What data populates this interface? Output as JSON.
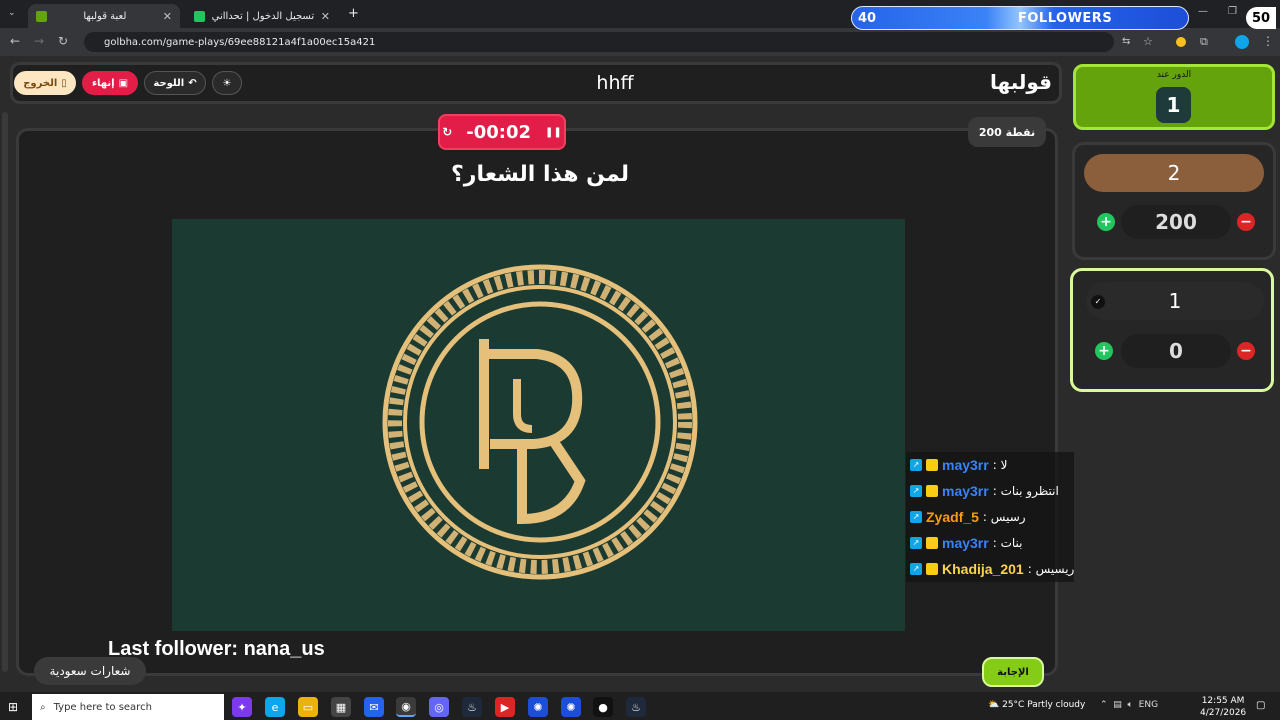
{
  "browser": {
    "tabs": [
      {
        "title": "لعبة قولبها",
        "active": true
      },
      {
        "title": "تسجيل الدخول | تحدااني",
        "active": false
      }
    ],
    "new_tab": "+",
    "url": "golbha.com/game-plays/69ee88121a4f1a00ec15a421"
  },
  "overlay": {
    "followers_count": "40",
    "followers_label": "FOLLOWERS",
    "corner_number": "50",
    "last_follower": "Last follower: nana_us"
  },
  "toolbar": {
    "exit_label": "الخروج",
    "end_label": "إنهاء",
    "board_label": "اللوحة",
    "title": "hhff",
    "logo": "قولبها"
  },
  "game": {
    "timer": "-00:02",
    "points": "200 نقطة",
    "question": "لمن هذا الشعار؟",
    "category": "شعارات سعودية",
    "answer_button": "الإجابة",
    "image_desc_icon": "circular-r-logo"
  },
  "turn": {
    "label": "الدور عند",
    "team": "1"
  },
  "teams": [
    {
      "name": "2",
      "score": "200",
      "name_color": "#8b5e3c"
    },
    {
      "name": "1",
      "score": "0",
      "name_color": "#2a2a2a"
    }
  ],
  "chat": [
    {
      "user": "may3rr",
      "user_color": "#3b82f6",
      "message": ": لا"
    },
    {
      "user": "may3rr",
      "user_color": "#3b82f6",
      "message": ": انتظرو بنات"
    },
    {
      "user": "Zyadf_5",
      "user_color": "#f59e0b",
      "message": ": رسيس"
    },
    {
      "user": "may3rr",
      "user_color": "#3b82f6",
      "message": ": بنات"
    },
    {
      "user": "Khadija_201",
      "user_color": "#fcd34d",
      "message": ": ريسيس"
    }
  ],
  "taskbar": {
    "search_placeholder": "Type here to search",
    "weather": "25°C  Partly cloudy",
    "lang": "ENG",
    "time": "12:55 AM",
    "date": "4/27/2026"
  },
  "colors": {
    "timer_bg": "#e11d48",
    "turn_bg": "#65a30d",
    "answer_bg": "#84cc16",
    "logo_gold": "#e5c07b",
    "image_bg": "#1a3a32"
  }
}
